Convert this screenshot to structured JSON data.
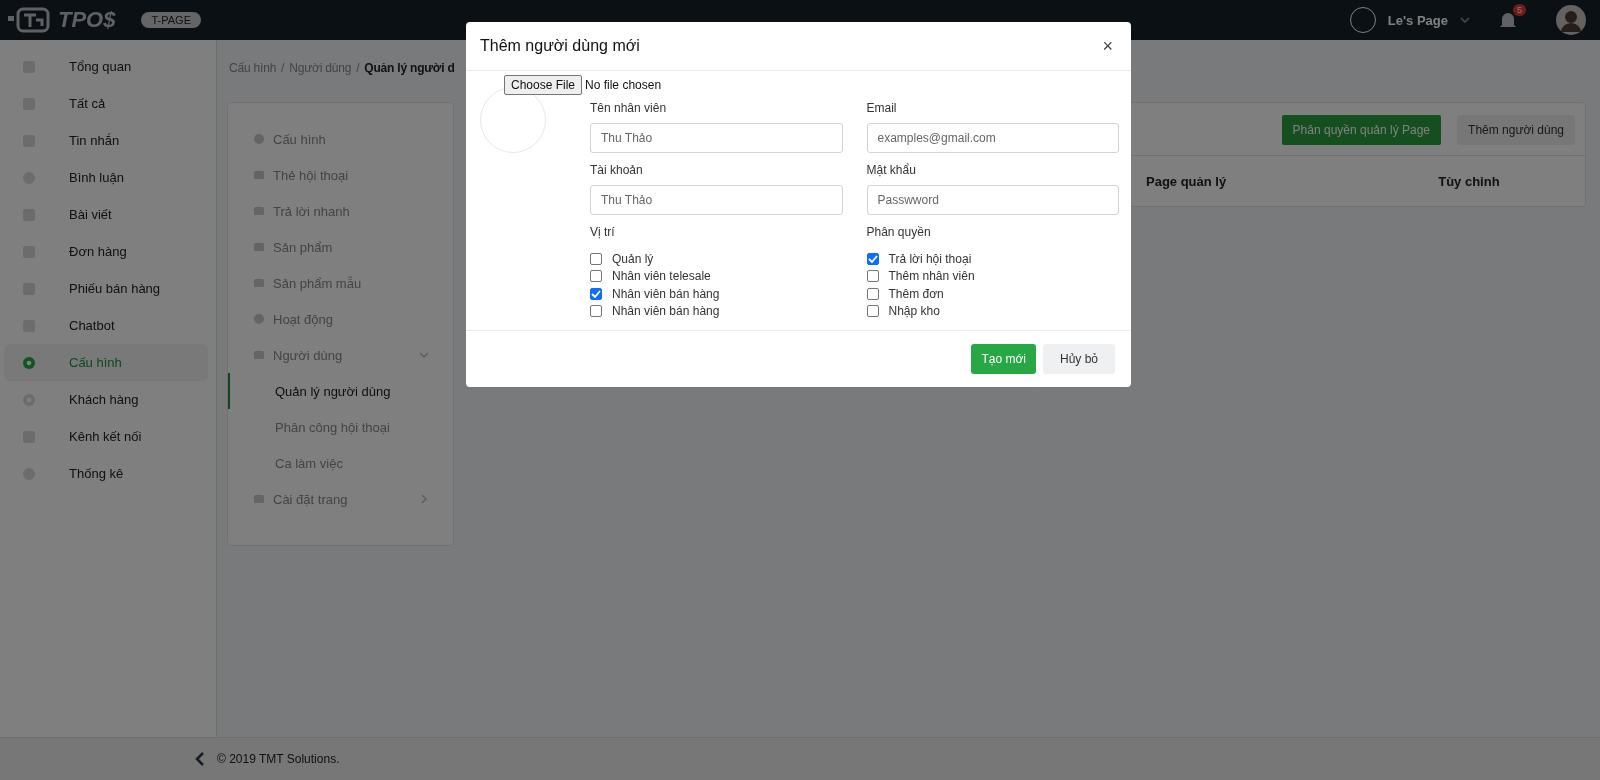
{
  "header": {
    "logo": "TPO$",
    "badge": "T-PAGE",
    "page_name": "Le's Page",
    "notification_count": "5"
  },
  "sidebar": {
    "items": [
      {
        "label": "Tổng quan",
        "selected": false
      },
      {
        "label": "Tất cả",
        "selected": false
      },
      {
        "label": "Tin nhắn",
        "selected": false
      },
      {
        "label": "Bình luận",
        "selected": false
      },
      {
        "label": "Bài viết",
        "selected": false
      },
      {
        "label": "Đơn hàng",
        "selected": false
      },
      {
        "label": "Phiếu bán hàng",
        "selected": false
      },
      {
        "label": "Chatbot",
        "selected": false
      },
      {
        "label": "Cấu hình",
        "selected": true
      },
      {
        "label": "Khách hàng",
        "selected": false
      },
      {
        "label": "Kênh kết nối",
        "selected": false
      },
      {
        "label": "Thống kê",
        "selected": false
      }
    ]
  },
  "breadcrumb": {
    "separator": "/",
    "items": [
      "Cấu hình",
      "Người dùng",
      "Quản lý người d"
    ]
  },
  "settings_menu": [
    {
      "label": "Cấu hình"
    },
    {
      "label": "Thẻ hội thoại"
    },
    {
      "label": "Trả lời nhanh"
    },
    {
      "label": "Sản phẩm"
    },
    {
      "label": "Sản phẩm mẫu"
    },
    {
      "label": "Hoạt động"
    },
    {
      "label": "Người dùng",
      "expanded": true,
      "children": [
        {
          "label": "Quản lý người dùng",
          "selected": true
        },
        {
          "label": "Phân công hội thoại",
          "selected": false
        },
        {
          "label": "Ca làm việc",
          "selected": false
        }
      ]
    },
    {
      "label": "Cài đặt trang",
      "expanded": false
    }
  ],
  "users_card": {
    "buttons": [
      {
        "label": "Phân quyền quản lý Page",
        "kind": "primary"
      },
      {
        "label": "Thêm người dùng",
        "kind": "secondary"
      }
    ],
    "columns": [
      "Page quản lý",
      "Tùy chỉnh"
    ]
  },
  "modal": {
    "title": "Thêm người dùng mới",
    "close": "×",
    "file_button": "Choose File",
    "file_status": "No file chosen",
    "fields": [
      {
        "label": "Tên nhân viên",
        "placeholder": "Thu Thảo"
      },
      {
        "label": "Email",
        "placeholder": "examples@gmail.com"
      },
      {
        "label": "Tài khoản",
        "placeholder": "Thu Thảo"
      },
      {
        "label": "Mật khẩu",
        "placeholder": "Passwword"
      }
    ],
    "groups": [
      {
        "label": "Vị trí",
        "options": [
          {
            "label": "Quản lý",
            "checked": false
          },
          {
            "label": "Nhân viên telesale",
            "checked": false
          },
          {
            "label": "Nhân viên bán hàng",
            "checked": true
          },
          {
            "label": "Nhân viên bán hàng",
            "checked": false
          }
        ]
      },
      {
        "label": "Phân quyền",
        "options": [
          {
            "label": "Trả lời hội thoại",
            "checked": true
          },
          {
            "label": "Thêm nhân viên",
            "checked": false
          },
          {
            "label": "Thêm đơn",
            "checked": false
          },
          {
            "label": "Nhập kho",
            "checked": false
          }
        ]
      }
    ],
    "buttons": [
      {
        "label": "Tạo mới",
        "kind": "primary"
      },
      {
        "label": "Hủy bỏ",
        "kind": "secondary"
      }
    ]
  },
  "footer": {
    "copyright": "© 2019 TMT Solutions."
  }
}
